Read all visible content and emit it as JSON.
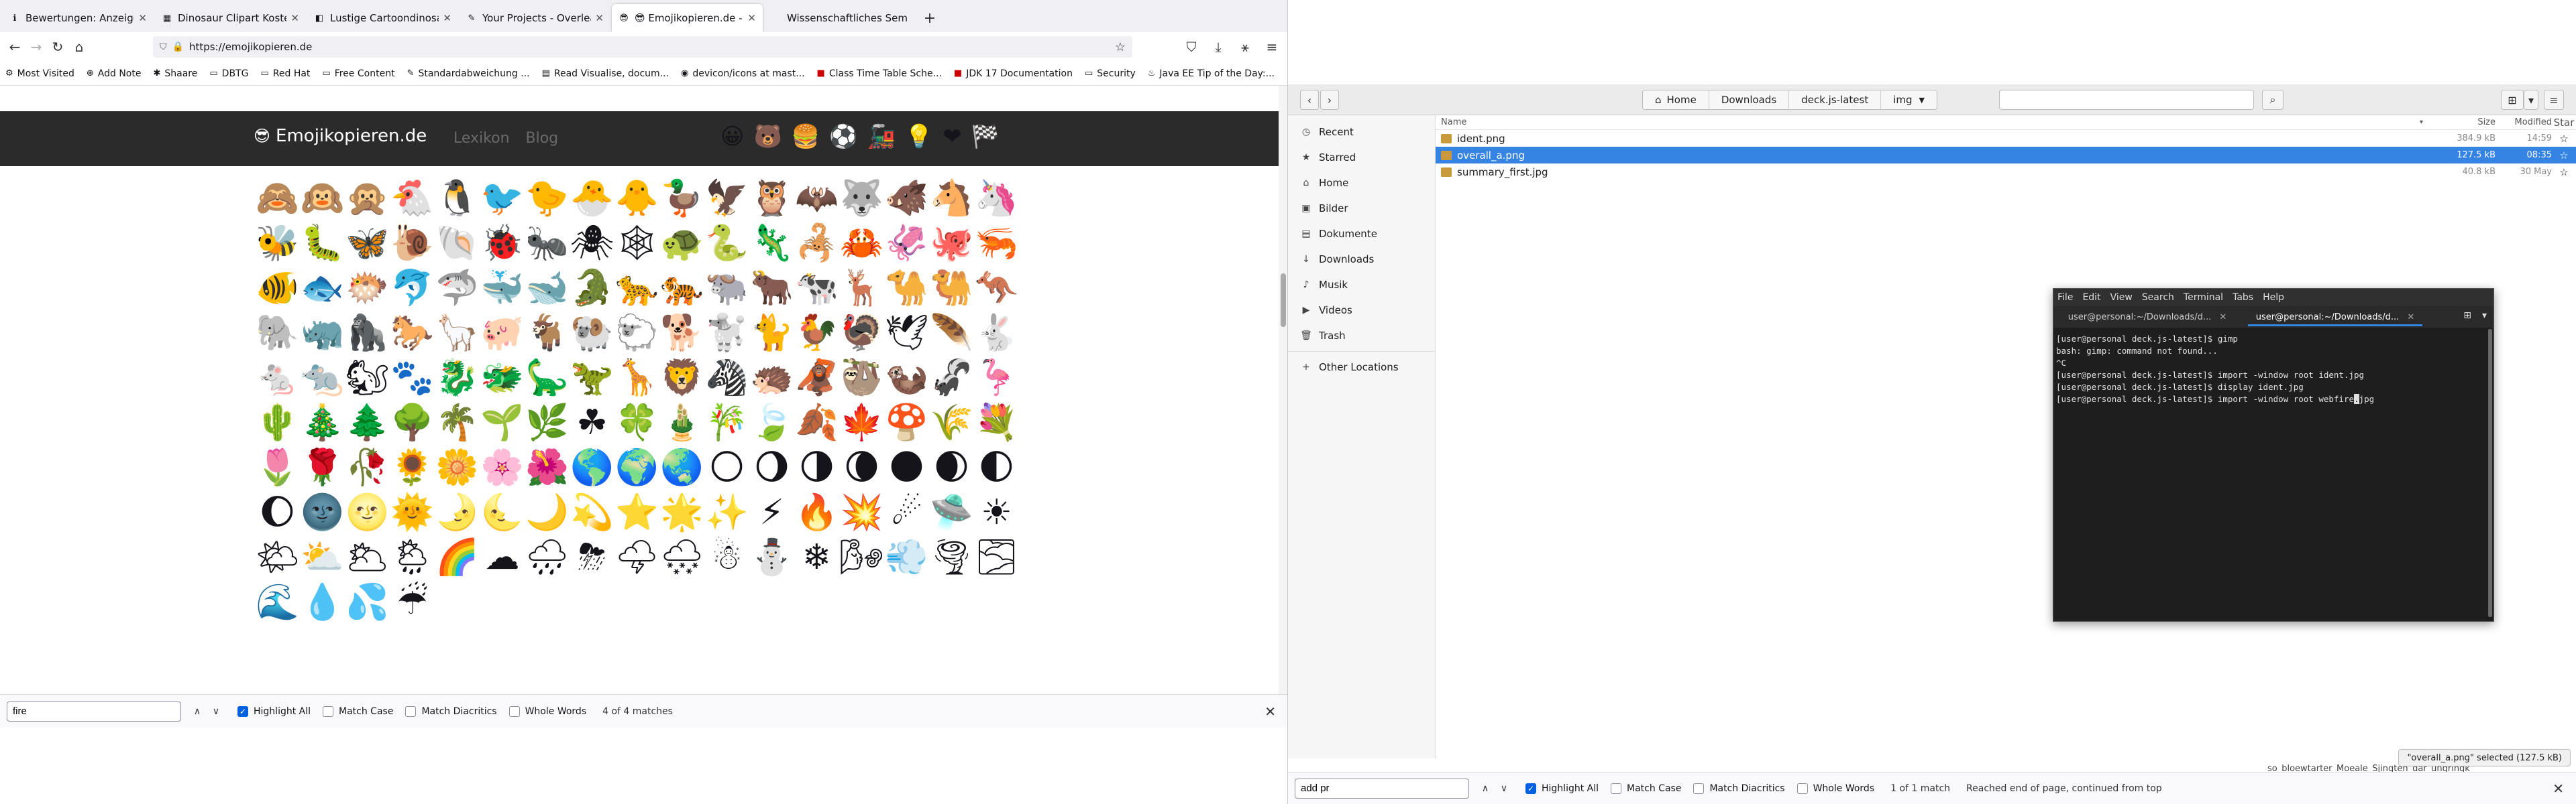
{
  "browser": {
    "tabs": [
      {
        "favicon": "ℹ",
        "title": "Bewertungen: Anzeigen"
      },
      {
        "favicon": "▦",
        "title": "Dinosaur Clipart Kostenl"
      },
      {
        "favicon": "◧",
        "title": "Lustige Cartoondinosauri"
      },
      {
        "favicon": "✎",
        "title": "Your Projects - Overleaf,"
      },
      {
        "favicon": "😎",
        "title": "😎 Emojikopieren.de - Em"
      },
      {
        "favicon": "",
        "title": "Wissenschaftliches Seminar"
      }
    ],
    "url": "https://emojikopieren.de",
    "bookmarks": [
      {
        "icon": "⚙",
        "label": "Most Visited"
      },
      {
        "icon": "⊕",
        "label": "Add Note"
      },
      {
        "icon": "✱",
        "label": "Shaare"
      },
      {
        "icon": "▭",
        "label": "DBTG"
      },
      {
        "icon": "▭",
        "label": "Red Hat"
      },
      {
        "icon": "▭",
        "label": "Free Content"
      },
      {
        "icon": "✎",
        "label": "Standardabweichung ..."
      },
      {
        "icon": "▤",
        "label": "Read Visualise, docum..."
      },
      {
        "icon": "◉",
        "label": "devicon/icons at mast..."
      },
      {
        "icon": "■",
        "label": "Class Time Table Sche..."
      },
      {
        "icon": "■",
        "label": "JDK 17 Documentation"
      },
      {
        "icon": "▭",
        "label": "Security"
      },
      {
        "icon": "♨",
        "label": "Java EE Tip of the Day:..."
      }
    ],
    "site": {
      "logo_emoji": "😎",
      "logo_text": "Emojikopieren.de",
      "nav": [
        "Lexikon",
        "Blog"
      ],
      "header_emojis": [
        "😀",
        "🐻",
        "🍔",
        "⚽",
        "🚂",
        "💡",
        "❤",
        "🏁"
      ],
      "emojis": [
        "🙈",
        "🙉",
        "🙊",
        "🐔",
        "🐧",
        "🐦",
        "🐤",
        "🐣",
        "🐥",
        "🦆",
        "🦅",
        "🦉",
        "🦇",
        "🐺",
        "🐗",
        "🐴",
        "🦄",
        "🐝",
        "🐛",
        "🦋",
        "🐌",
        "🐚",
        "🐞",
        "🐜",
        "🕷",
        "🕸",
        "🐢",
        "🐍",
        "🦎",
        "🦂",
        "🦀",
        "🦑",
        "🐙",
        "🦐",
        "🐠",
        "🐟",
        "🐡",
        "🐬",
        "🦈",
        "🐳",
        "🐋",
        "🐊",
        "🐆",
        "🐅",
        "🐃",
        "🐂",
        "🐄",
        "🦌",
        "🐪",
        "🐫",
        "🦘",
        "🐘",
        "🦏",
        "🦍",
        "🐎",
        "🦙",
        "🐖",
        "🐐",
        "🐏",
        "🐑",
        "🐕",
        "🐩",
        "🐈",
        "🐓",
        "🦃",
        "🕊",
        "🪶",
        "🐇",
        "🐁",
        "🐀",
        "🐿",
        "🐾",
        "🐉",
        "🐲",
        "🦕",
        "🦖",
        "🦒",
        "🦁",
        "🦓",
        "🦔",
        "🦧",
        "🦥",
        "🦦",
        "🦨",
        "🦩",
        "🌵",
        "🎄",
        "🌲",
        "🌳",
        "🌴",
        "🌱",
        "🌿",
        "☘",
        "🍀",
        "🎍",
        "🎋",
        "🍃",
        "🍂",
        "🍁",
        "🍄",
        "🌾",
        "💐",
        "🌷",
        "🌹",
        "🥀",
        "🌻",
        "🌼",
        "🌸",
        "🌺",
        "🌎",
        "🌍",
        "🌏",
        "🌕",
        "🌖",
        "🌗",
        "🌘",
        "🌑",
        "🌒",
        "🌓",
        "🌔",
        "🌚",
        "🌝",
        "🌞",
        "🌛",
        "🌜",
        "🌙",
        "💫",
        "⭐",
        "🌟",
        "✨",
        "⚡",
        "🔥",
        "💥",
        "☄",
        "🛸",
        "☀",
        "🌤",
        "⛅",
        "🌥",
        "🌦",
        "🌈",
        "☁",
        "🌧",
        "⛈",
        "🌩",
        "🌨",
        "☃",
        "⛄",
        "❄",
        "🌬",
        "💨",
        "🌪",
        "🌫",
        "🌊",
        "💧",
        "💦",
        "☔"
      ]
    },
    "find": {
      "query": "fire",
      "highlight_all": "Highlight All",
      "match_case": "Match Case",
      "match_diacritics": "Match Diacritics",
      "whole_words": "Whole Words",
      "status": "4 of 4 matches"
    }
  },
  "files": {
    "path": [
      "Home",
      "Downloads",
      "deck.js-latest",
      "img"
    ],
    "sidebar": [
      {
        "icon": "◷",
        "label": "Recent"
      },
      {
        "icon": "★",
        "label": "Starred"
      },
      {
        "icon": "⌂",
        "label": "Home"
      },
      {
        "icon": "▣",
        "label": "Bilder"
      },
      {
        "icon": "▤",
        "label": "Dokumente"
      },
      {
        "icon": "↓",
        "label": "Downloads"
      },
      {
        "icon": "♪",
        "label": "Musik"
      },
      {
        "icon": "▶",
        "label": "Videos"
      },
      {
        "icon": "🗑",
        "label": "Trash"
      }
    ],
    "other_locations": "Other Locations",
    "columns": {
      "name": "Name",
      "size": "Size",
      "modified": "Modified",
      "star": "Star"
    },
    "rows": [
      {
        "name": "ident.png",
        "size": "384.9 kB",
        "modified": "14:59",
        "star": "☆"
      },
      {
        "name": "overall_a.png",
        "size": "127.5 kB",
        "modified": "08:35",
        "star": "☆"
      },
      {
        "name": "summary_first.jpg",
        "size": "40.8 kB",
        "modified": "30 May",
        "star": "☆"
      }
    ],
    "status": "\"overall_a.png\" selected (127.5 kB)",
    "background_text": "so_bloewtarter_Moeale_Sjingten_dar_ungringk",
    "find": {
      "query": "add pr",
      "highlight_all": "Highlight All",
      "match_case": "Match Case",
      "match_diacritics": "Match Diacritics",
      "whole_words": "Whole Words",
      "status": "1 of 1 match",
      "note": "Reached end of page, continued from top"
    }
  },
  "terminal": {
    "menu": [
      "File",
      "Edit",
      "View",
      "Search",
      "Terminal",
      "Tabs",
      "Help"
    ],
    "tabs": [
      "user@personal:~/Downloads/d...",
      "user@personal:~/Downloads/d..."
    ],
    "lines": [
      "[user@personal deck.js-latest]$ gimp",
      "bash: gimp: command not found...",
      "^C",
      "[user@personal deck.js-latest]$ import -window root ident.jpg",
      "[user@personal deck.js-latest]$ display ident.jpg"
    ],
    "last_prompt": "[user@personal deck.js-latest]$ import -window root webfire",
    "last_cursor": ".",
    "last_tail": "jpg"
  }
}
